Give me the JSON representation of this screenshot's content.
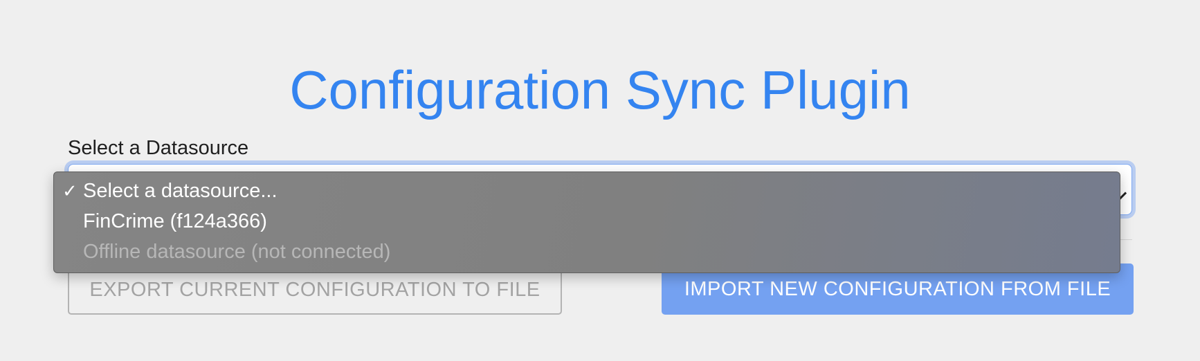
{
  "page": {
    "title": "Configuration Sync Plugin"
  },
  "datasource": {
    "label": "Select a Datasource",
    "selected_value": "Select a datasource...",
    "options": [
      {
        "label": "Select a datasource...",
        "selected": true,
        "disabled": false,
        "check_glyph": "✓"
      },
      {
        "label": "FinCrime (f124a366)",
        "selected": false,
        "disabled": false
      },
      {
        "label": "Offline datasource (not connected)",
        "selected": false,
        "disabled": true
      }
    ]
  },
  "actions": {
    "export_label": "EXPORT CURRENT CONFIGURATION TO FILE",
    "import_label": "IMPORT NEW CONFIGURATION FROM FILE"
  },
  "colors": {
    "title": "#3484f0",
    "import_button": "#74a1f1",
    "export_border": "#b3b3b3",
    "dropdown_bg": "#808080",
    "disabled_option_text": "#b7b7b7"
  },
  "icons": {
    "select_chevron": "chevron-down-icon",
    "selected_check": "checkmark-icon"
  }
}
